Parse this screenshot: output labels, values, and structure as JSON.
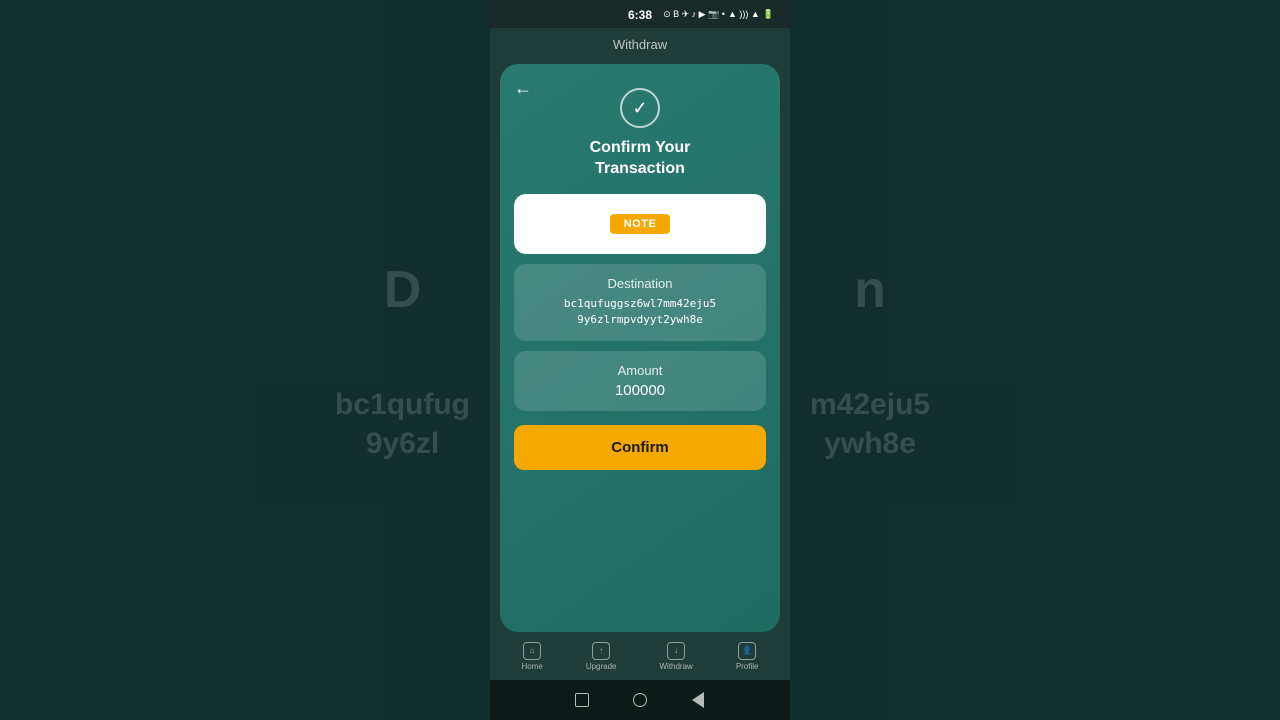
{
  "status_bar": {
    "time": "6:38"
  },
  "header": {
    "title": "Withdraw"
  },
  "card": {
    "back_label": "←",
    "check_icon": "✓",
    "title_line1": "Confirm Your",
    "title_line2": "Transaction",
    "note_badge": "NOTE",
    "destination_label": "Destination",
    "destination_value": "bc1qufuggsz6wl7mm42eju59y6zlrmpvdyyt2ywh8e",
    "destination_line1": "bc1qufuggsz6wl7mm42eju5",
    "destination_line2": "9y6zlrmpvdyyt2ywh8e",
    "amount_label": "Amount",
    "amount_value": "100000",
    "confirm_label": "Confirm"
  },
  "bottom_nav": {
    "items": [
      {
        "label": "Home",
        "icon": "⌂"
      },
      {
        "label": "Upgrade",
        "icon": "↑"
      },
      {
        "label": "Withdraw",
        "icon": "↓"
      },
      {
        "label": "Profile",
        "icon": "👤"
      }
    ]
  },
  "bg_text_left": "D",
  "bg_text_right": "n",
  "bg_address_left": "bc1qufug",
  "bg_address_mid": "m42eju5",
  "bg_address_bot_left": "9y6zl",
  "bg_address_bot_right": "ywh8e"
}
